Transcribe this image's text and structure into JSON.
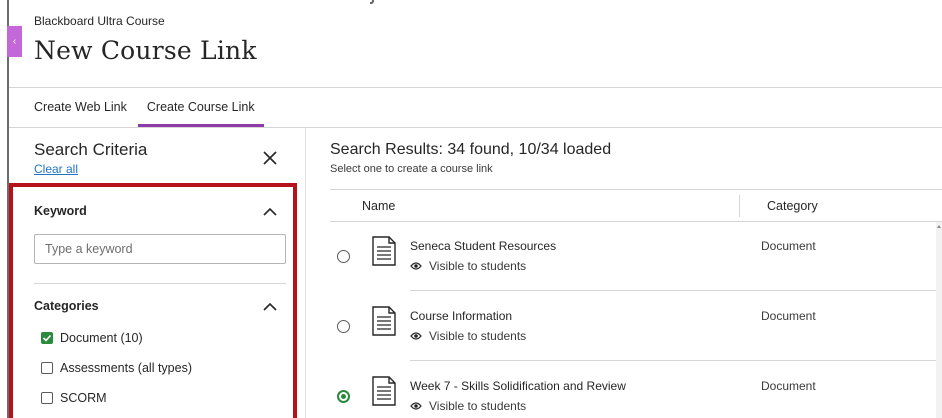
{
  "header": {
    "course_name": "Blackboard Ultra Course",
    "page_title": "New Course Link"
  },
  "tabs": [
    {
      "label": "Create Web Link",
      "active": false
    },
    {
      "label": "Create Course Link",
      "active": true
    }
  ],
  "search_criteria": {
    "title": "Search Criteria",
    "clear_all": "Clear all",
    "keyword": {
      "label": "Keyword",
      "placeholder": "Type a keyword",
      "value": ""
    },
    "categories": {
      "label": "Categories",
      "items": [
        {
          "label": "Document (10)",
          "checked": true
        },
        {
          "label": "Assessments (all types)",
          "checked": false
        },
        {
          "label": "SCORM",
          "checked": false
        }
      ]
    }
  },
  "results": {
    "title": "Search Results: 34 found, 10/34 loaded",
    "subtitle": "Select one to create a course link",
    "columns": {
      "name": "Name",
      "category": "Category"
    },
    "rows": [
      {
        "title": "Seneca Student Resources",
        "visibility": "Visible to students",
        "category": "Document",
        "selected": false
      },
      {
        "title": "Course Information",
        "visibility": "Visible to students",
        "category": "Document",
        "selected": false
      },
      {
        "title": "Week 7 - Skills Solidification and Review",
        "visibility": "Visible to students",
        "category": "Document",
        "selected": true
      }
    ]
  },
  "colors": {
    "accent_purple": "#8e3aa8",
    "highlight_red": "#b5121b",
    "check_green": "#2a8a3e",
    "link_blue": "#1f74c4"
  },
  "icons": {
    "close": "close-icon",
    "chevron": "chevron-up-icon",
    "document": "document-icon",
    "visibility": "eye-icon",
    "checkbox_checked": "checkmark-icon"
  }
}
